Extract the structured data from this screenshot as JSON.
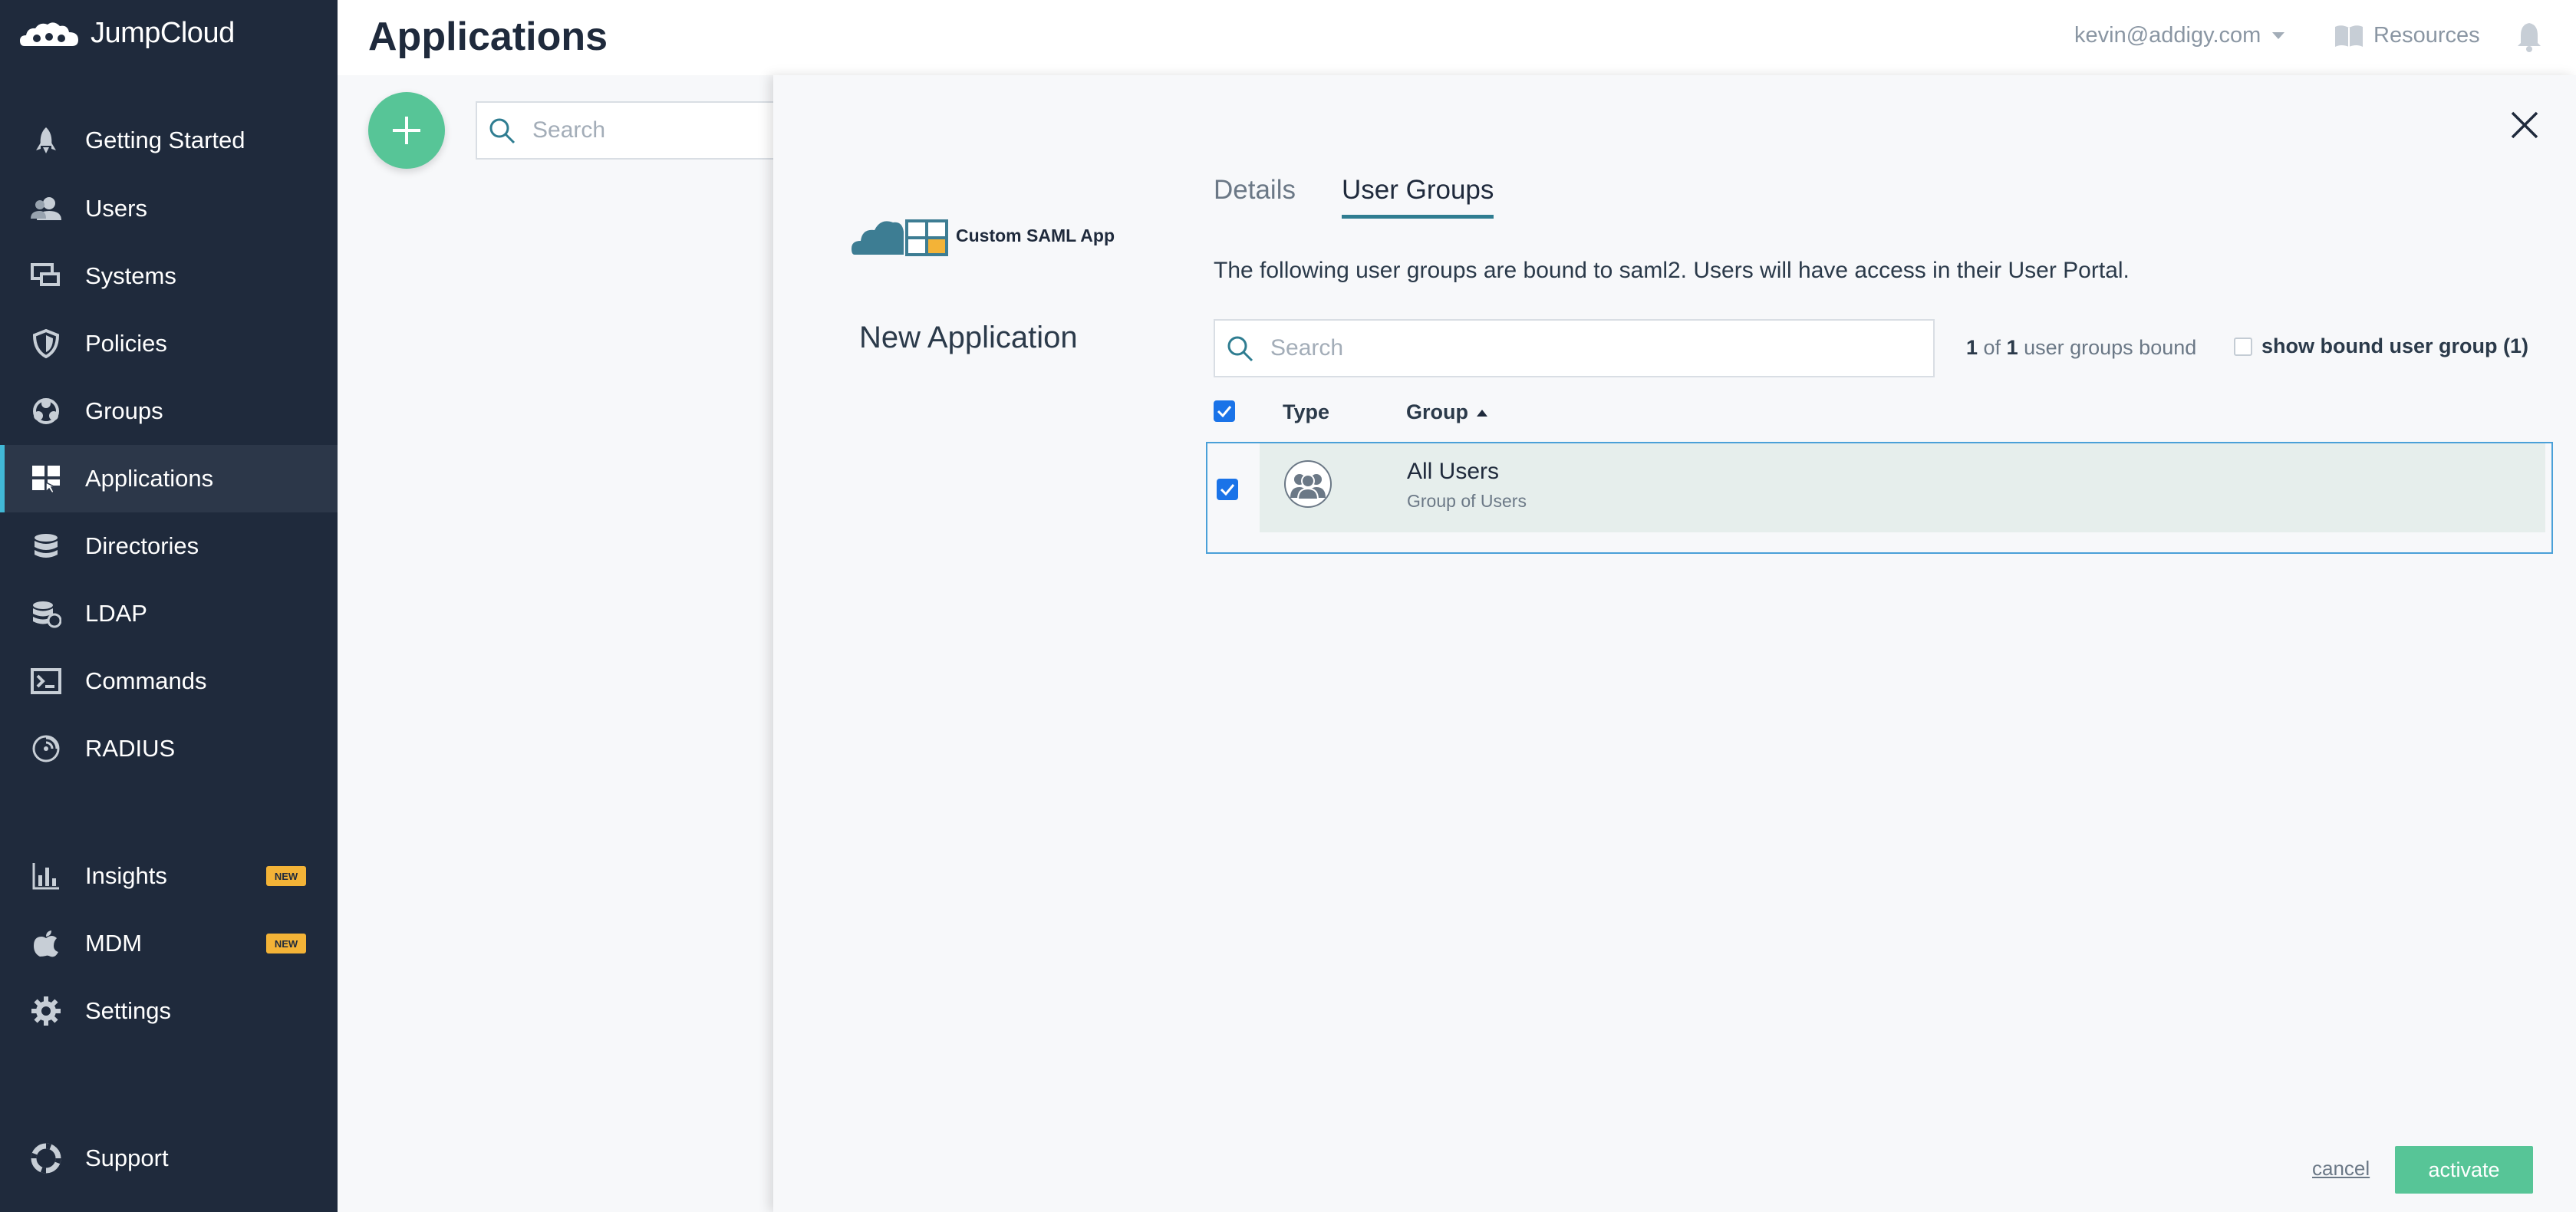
{
  "brand": {
    "name": "JumpCloud"
  },
  "sidebar": {
    "items": [
      {
        "label": "Getting Started",
        "icon": "rocket-icon"
      },
      {
        "label": "Users",
        "icon": "users-icon"
      },
      {
        "label": "Systems",
        "icon": "systems-icon"
      },
      {
        "label": "Policies",
        "icon": "shield-icon"
      },
      {
        "label": "Groups",
        "icon": "groups-icon"
      },
      {
        "label": "Applications",
        "icon": "applications-icon",
        "active": true
      },
      {
        "label": "Directories",
        "icon": "database-icon"
      },
      {
        "label": "LDAP",
        "icon": "ldap-icon"
      },
      {
        "label": "Commands",
        "icon": "terminal-icon"
      },
      {
        "label": "RADIUS",
        "icon": "radius-icon"
      },
      {
        "label": "Insights",
        "icon": "bar-chart-icon",
        "badge": "NEW"
      },
      {
        "label": "MDM",
        "icon": "apple-icon",
        "badge": "NEW"
      },
      {
        "label": "Settings",
        "icon": "gear-icon"
      },
      {
        "label": "Support",
        "icon": "lifebuoy-icon"
      }
    ]
  },
  "header": {
    "title": "Applications",
    "user": "kevin@addigy.com",
    "resources": "Resources"
  },
  "background": {
    "search_placeholder": "Search"
  },
  "panel": {
    "app_logo_label": "Custom SAML App",
    "heading": "New Application",
    "tabs": [
      {
        "label": "Details",
        "active": false
      },
      {
        "label": "User Groups",
        "active": true
      }
    ],
    "description": "The following user groups are bound to saml2. Users will have access in their User Portal.",
    "search_placeholder": "Search",
    "bound_count": {
      "bound": "1",
      "of": " of ",
      "total": "1",
      "suffix": " user groups bound"
    },
    "show_bound_label": "show bound user group (1)",
    "columns": {
      "type": "Type",
      "group": "Group"
    },
    "rows": [
      {
        "name": "All Users",
        "subtitle": "Group of Users",
        "checked": true
      }
    ],
    "cancel_label": "cancel",
    "activate_label": "activate"
  },
  "colors": {
    "sidebar_bg": "#1f2a3c",
    "accent_green": "#57c597",
    "tab_underline": "#2f7d91",
    "badge_new": "#f3b337",
    "selection_border": "#4aa0d8"
  }
}
